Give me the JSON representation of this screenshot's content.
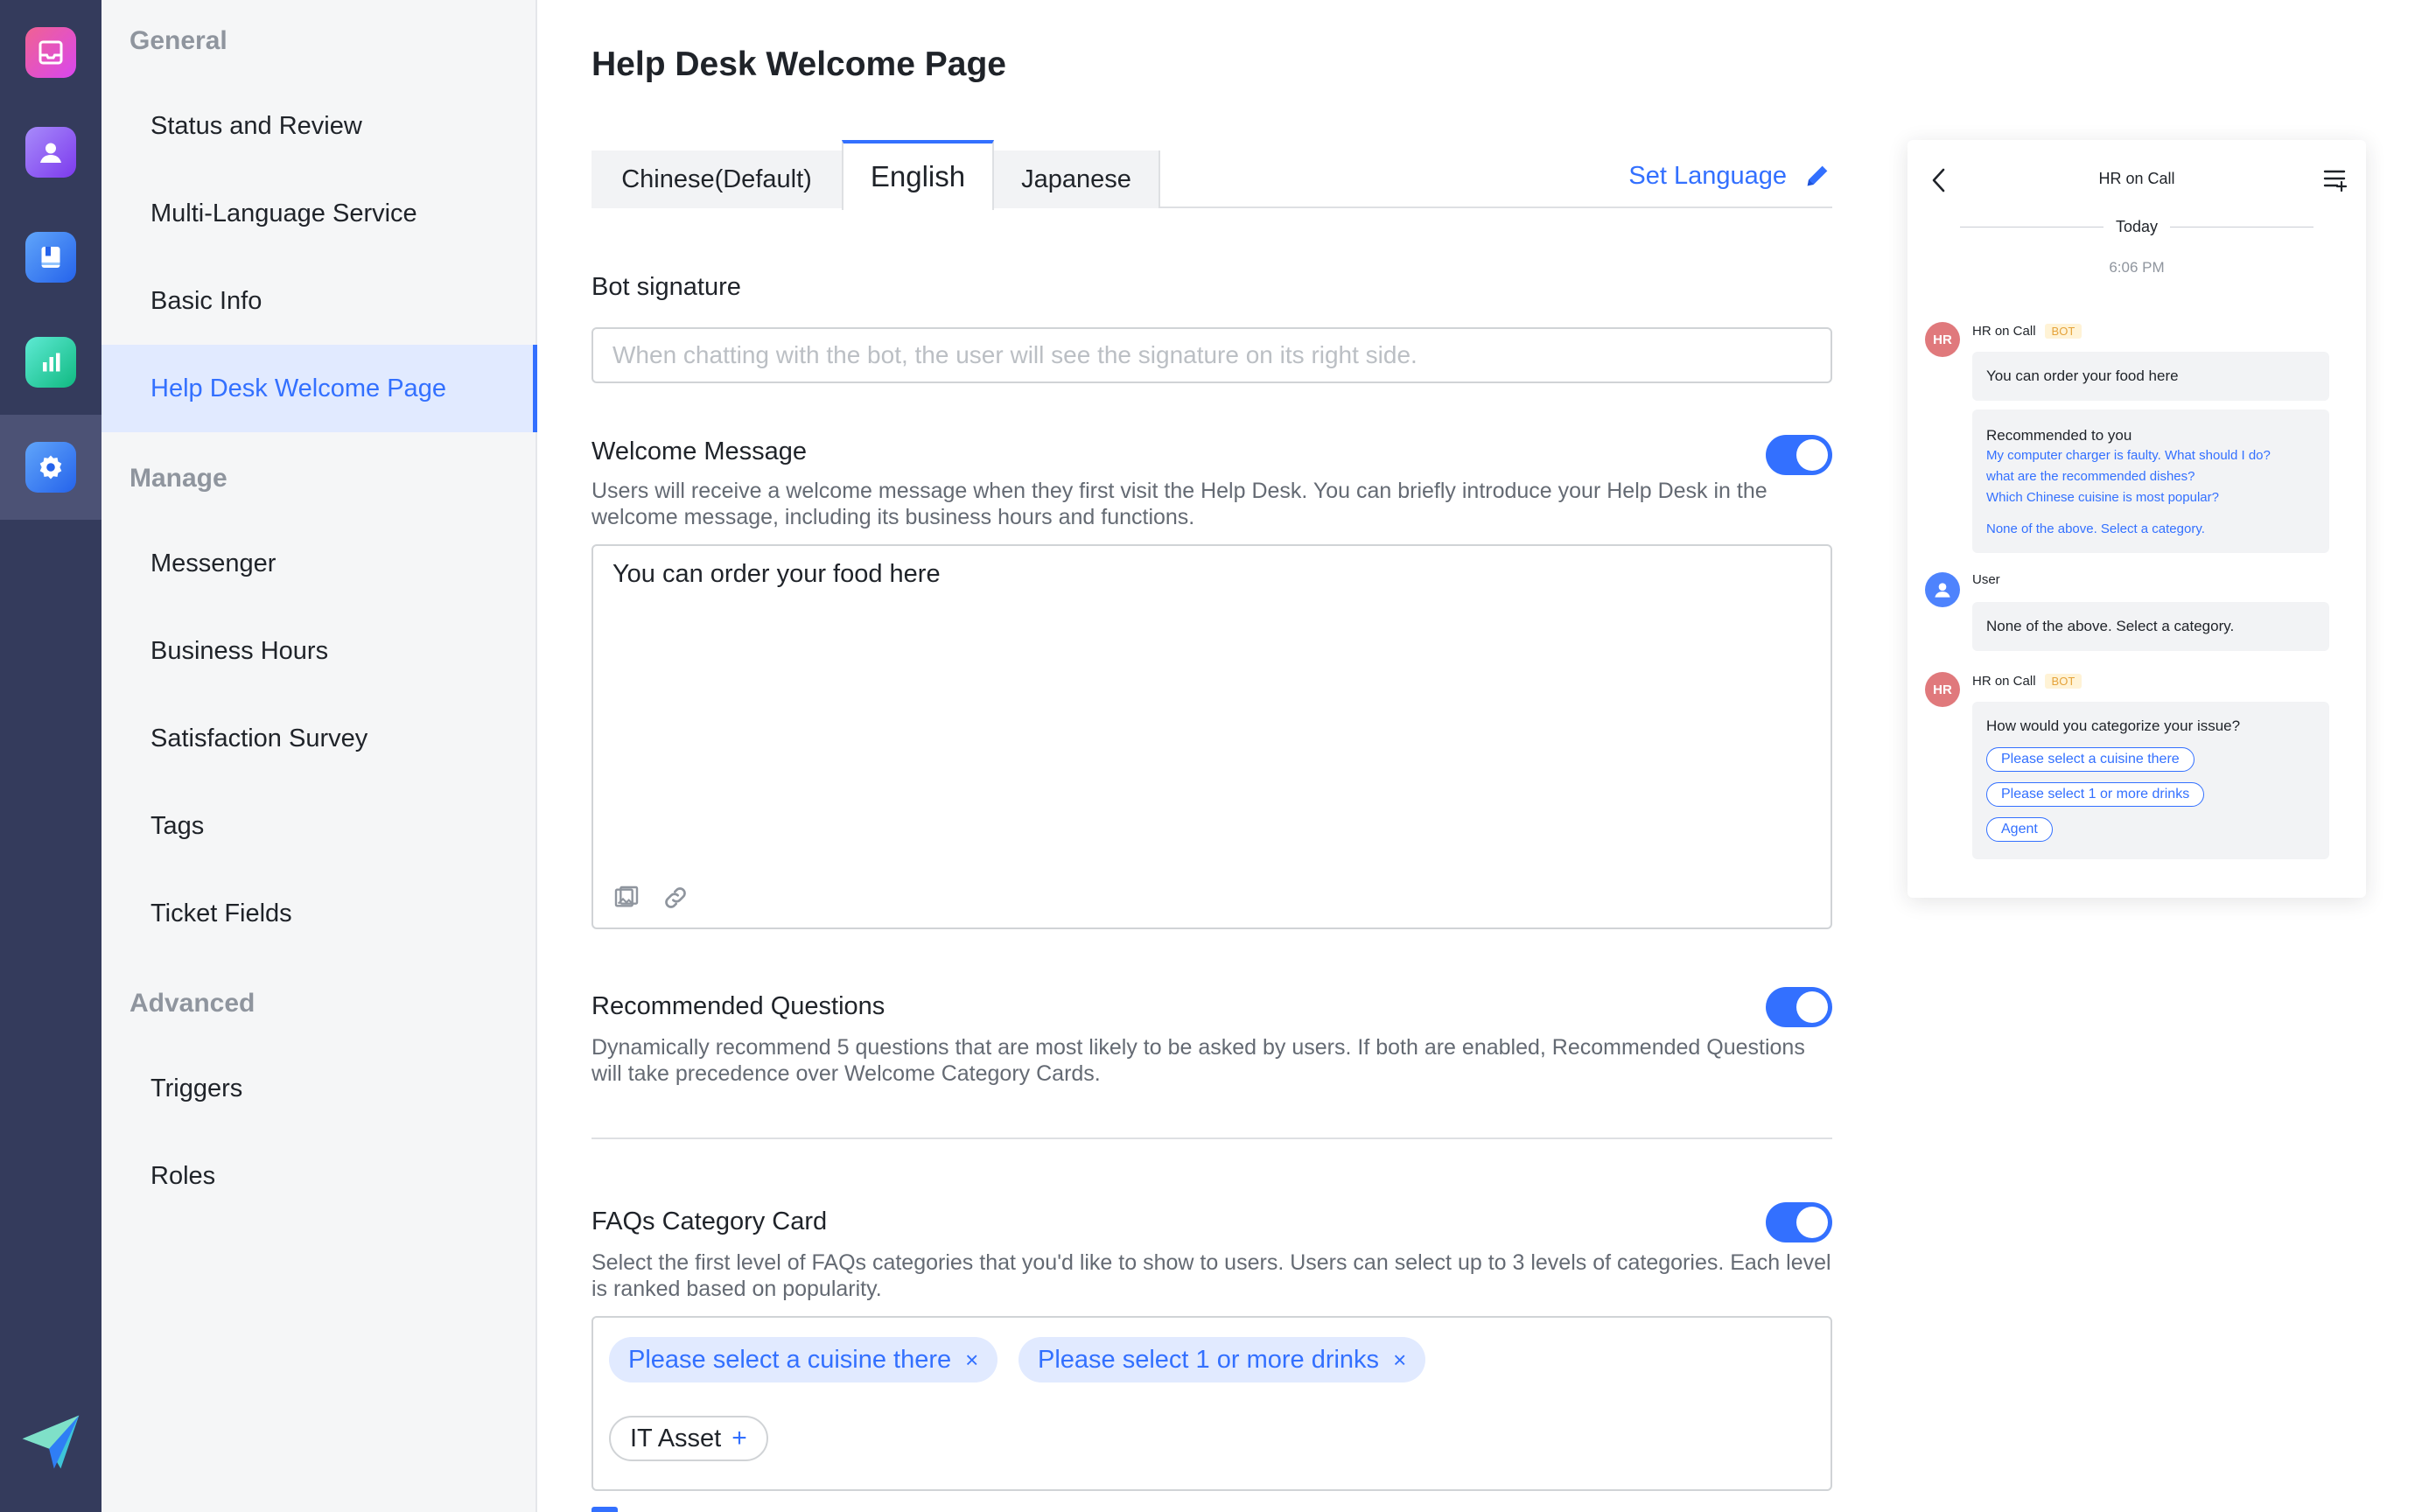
{
  "rail": {
    "items": [
      {
        "name": "inbox",
        "icon": "inbox-icon",
        "color": "#e452a4"
      },
      {
        "name": "agent",
        "icon": "person-icon",
        "color": "#8b5cf6"
      },
      {
        "name": "knowledge",
        "icon": "book-icon",
        "color": "#3e7bfa"
      },
      {
        "name": "analytics",
        "icon": "bar-chart-icon",
        "color": "#3fc0a2"
      },
      {
        "name": "settings",
        "icon": "gear-icon",
        "color": "#3e7bfa",
        "active": true
      }
    ],
    "logo_icon": "paper-plane-logo-icon"
  },
  "sidebar": {
    "groups": {
      "general": "General",
      "manage": "Manage",
      "advanced": "Advanced"
    },
    "items": {
      "status_review": "Status and Review",
      "multi_language": "Multi-Language Service",
      "basic_info": "Basic Info",
      "help_desk_welcome": "Help Desk Welcome Page",
      "messenger": "Messenger",
      "business_hours": "Business Hours",
      "satisfaction_survey": "Satisfaction Survey",
      "tags": "Tags",
      "ticket_fields": "Ticket Fields",
      "triggers": "Triggers",
      "roles": "Roles"
    },
    "active": "help_desk_welcome"
  },
  "main": {
    "title": "Help Desk Welcome Page",
    "tabs": {
      "chinese": "Chinese(Default)",
      "english": "English",
      "japanese": "Japanese",
      "active": "english"
    },
    "set_language": "Set Language",
    "bot_signature": {
      "label": "Bot signature",
      "value": "",
      "placeholder": "When chatting with the bot, the user will see the signature on its right side."
    },
    "welcome_message": {
      "label": "Welcome Message",
      "enabled": true,
      "description": "Users will receive a welcome message when they first visit the Help Desk. You can briefly introduce your Help Desk in the welcome message, including its business hours and functions.",
      "value": "You can order your food here"
    },
    "recommended_questions": {
      "label": "Recommended Questions",
      "enabled": true,
      "description": "Dynamically recommend 5 questions that are most likely to be asked by users. If both are enabled, Recommended Questions will take precedence over Welcome Category Cards."
    },
    "faq_card": {
      "label": "FAQs Category Card",
      "enabled": true,
      "description": "Select the first level of FAQs categories that you'd like to show to users. Users can select up to 3 levels of categories. Each level is ranked based on popularity.",
      "chips": [
        "Please select a cuisine there",
        "Please select 1 or more drinks"
      ],
      "chip_remove": "×",
      "add_chip": "IT Asset",
      "add_symbol": "+"
    }
  },
  "preview": {
    "title": "HR on Call",
    "date_divider": "Today",
    "time": "6:06 PM",
    "avatar_hr": "HR",
    "bot_badge": "BOT",
    "messages": {
      "m1_sender": "HR on Call",
      "m1_text": "You can order your food here",
      "m2_title": "Recommended to you",
      "m2_q1": "My computer charger is faulty. What should I do?",
      "m2_q2": "what are the recommended dishes?",
      "m2_q3": "Which Chinese cuisine is most popular?",
      "m2_none": "None of the above. Select a category.",
      "m3_sender": "User",
      "m3_text": "None of the above. Select a category.",
      "m4_sender": "HR on Call",
      "m4_text": "How would you categorize your issue?",
      "m4_btn1": "Please select a cuisine there",
      "m4_btn2": "Please select 1 or more drinks",
      "m4_btn3": "Agent"
    }
  }
}
